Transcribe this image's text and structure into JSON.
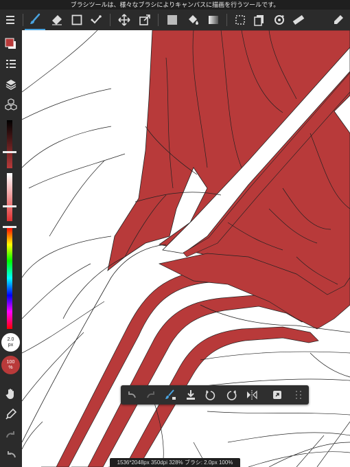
{
  "hint_text": "ブラシツールは、様々なブラシによりキャンバスに描画を行うツールです。",
  "toolbar": {
    "items": [
      "menu-icon",
      "brush-icon",
      "eraser-icon",
      "rectangle-select-icon",
      "wand-icon",
      "move-icon",
      "transform-icon",
      "fill-color-icon",
      "bucket-icon",
      "gradient-icon",
      "selection-icon",
      "layers-copy-icon",
      "rotate-icon",
      "ruler-icon",
      "eyedropper-icon"
    ]
  },
  "sidebar": {
    "brush_size": "2.0",
    "brush_size_unit": "px",
    "opacity": "100",
    "opacity_unit": "%",
    "current_color": "#b93a3a",
    "brightness_slider_level": 0.32,
    "saturation_slider_level": 0.74,
    "hue_slider_level": 0.0
  },
  "quick_bar": {
    "items": [
      "undo-icon",
      "redo-icon",
      "brush-eraser-toggle-icon",
      "import-icon",
      "rotate-left-icon",
      "rotate-right-icon",
      "flip-horizontal-icon",
      "expand-icon",
      "grid-icon"
    ]
  },
  "status_bar": {
    "text": "1536*2048px 350dpi 328% ブラシ: 2.0px 100%"
  },
  "colors": {
    "ui_dark": "#2b2b2b",
    "accent": "#4aa3df",
    "fabric_red": "#b83a3a"
  }
}
